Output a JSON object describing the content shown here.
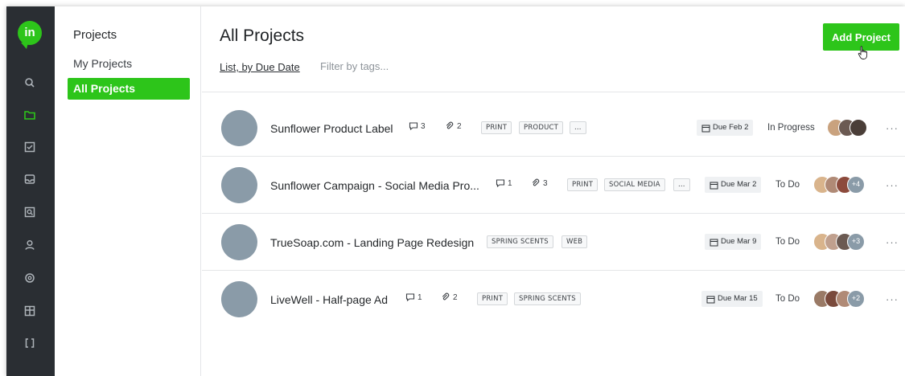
{
  "app": {
    "logo_text": "in"
  },
  "rail": {
    "icons": [
      "search-icon",
      "folder-icon",
      "checklist-icon",
      "inbox-icon",
      "inspect-icon",
      "user-icon",
      "mention-icon",
      "layout-icon",
      "brackets-icon"
    ],
    "active": "folder-icon",
    "accent": "#2dc51a",
    "background": "#2a2e33"
  },
  "sidebar": {
    "title": "Projects",
    "items": [
      {
        "label": "My Projects",
        "active": false
      },
      {
        "label": "All Projects",
        "active": true
      }
    ]
  },
  "header": {
    "title": "All Projects",
    "add_button": "Add Project",
    "view_toggle": "List, by Due Date",
    "filter_placeholder": "Filter by tags..."
  },
  "projects": [
    {
      "name": "Sunflower Product Label",
      "comments": "3",
      "attachments": "2",
      "tags": [
        "PRINT",
        "PRODUCT",
        "..."
      ],
      "due": "Due Feb 2",
      "status": "In Progress",
      "avatar_colors": [
        "#c9a27e",
        "#6b5a52",
        "#4a3e38"
      ],
      "more_count": ""
    },
    {
      "name": "Sunflower Campaign - Social Media Pro...",
      "comments": "1",
      "attachments": "3",
      "tags": [
        "PRINT",
        "SOCIAL MEDIA",
        "..."
      ],
      "due": "Due Mar 2",
      "status": "To Do",
      "avatar_colors": [
        "#d9b48c",
        "#b08a76",
        "#8c4a3c"
      ],
      "more_count": "+4"
    },
    {
      "name": "TrueSoap.com - Landing Page Redesign",
      "comments": "",
      "attachments": "",
      "tags": [
        "SPRING SCENTS",
        "WEB"
      ],
      "due": "Due Mar 9",
      "status": "To Do",
      "avatar_colors": [
        "#d9b48c",
        "#c0a08e",
        "#6b5a52"
      ],
      "more_count": "+3"
    },
    {
      "name": "LiveWell - Half-page Ad",
      "comments": "1",
      "attachments": "2",
      "tags": [
        "PRINT",
        "SPRING SCENTS"
      ],
      "due": "Due Mar 15",
      "status": "To Do",
      "avatar_colors": [
        "#9a7a66",
        "#7a4a3c",
        "#b08a76"
      ],
      "more_count": "+2"
    }
  ]
}
